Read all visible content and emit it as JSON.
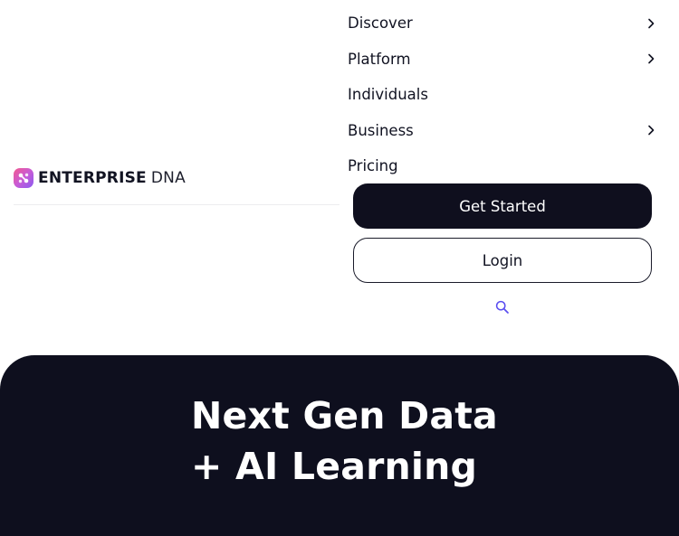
{
  "brand": {
    "name_bold": "ENTERPRISE",
    "name_light": "DNA",
    "icon": "dna-logo-icon",
    "gradient": [
      "#f35a8e",
      "#c85bd6",
      "#8a5bf0"
    ]
  },
  "nav": {
    "items": [
      {
        "label": "Discover",
        "has_submenu": true
      },
      {
        "label": "Platform",
        "has_submenu": true
      },
      {
        "label": "Individuals",
        "has_submenu": false
      },
      {
        "label": "Business",
        "has_submenu": true
      },
      {
        "label": "Pricing",
        "has_submenu": false
      }
    ],
    "submenu_icon": "chevron-right-icon"
  },
  "actions": {
    "get_started_label": "Get Started",
    "login_label": "Login",
    "search_icon": "search-icon"
  },
  "hero": {
    "title_line1": "Next Gen Data",
    "title_line2": "+ AI Learning"
  },
  "colors": {
    "primary_dark": "#0e0f1e",
    "search_accent": "#5a4df0",
    "text": "#111322"
  }
}
